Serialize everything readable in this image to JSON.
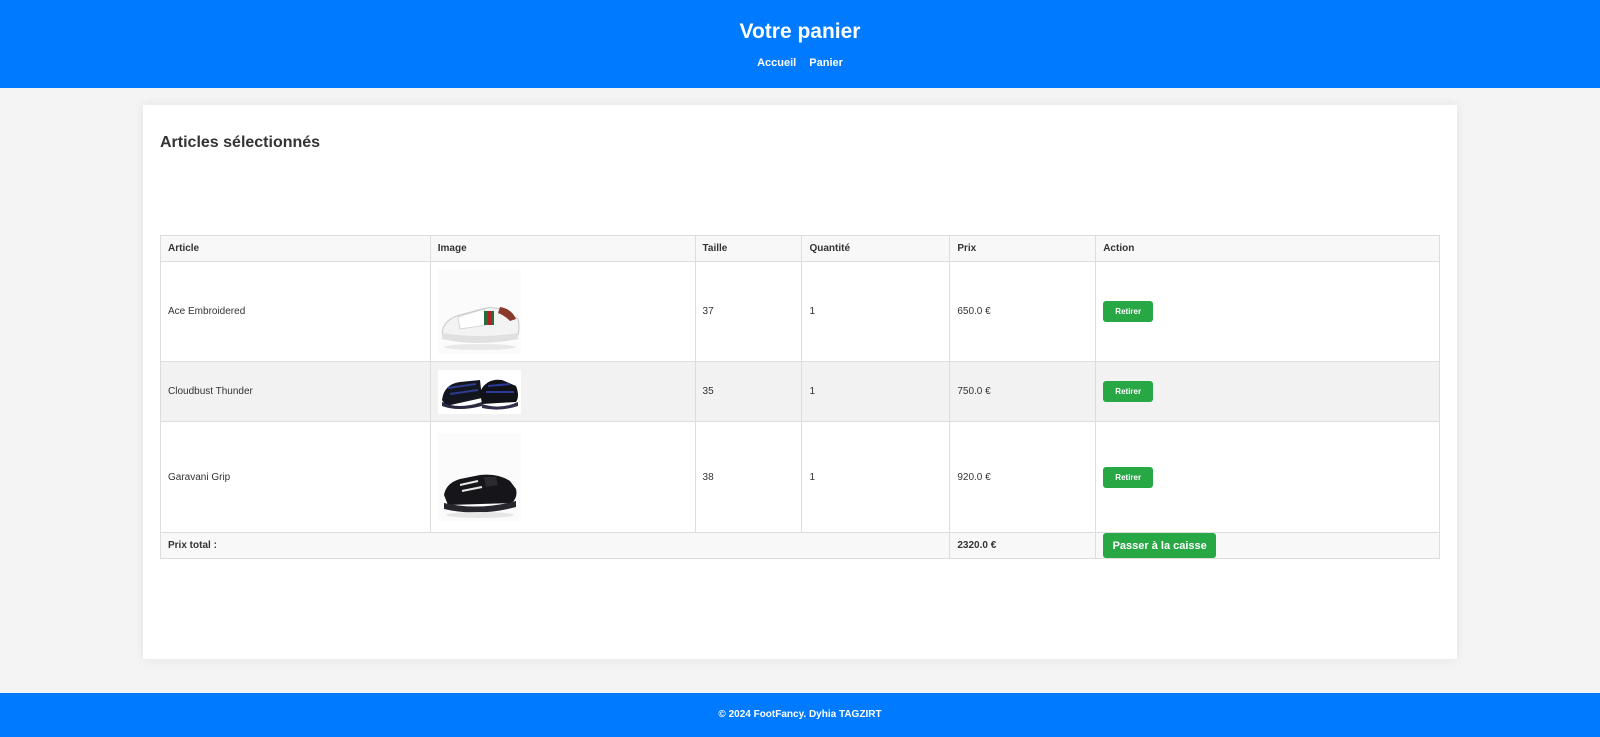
{
  "header": {
    "title": "Votre panier",
    "nav": [
      {
        "label": "Accueil"
      },
      {
        "label": "Panier"
      }
    ]
  },
  "main": {
    "section_title": "Articles sélectionnés",
    "table": {
      "headers": [
        "Article",
        "Image",
        "Taille",
        "Quantité",
        "Prix",
        "Action"
      ],
      "rows": [
        {
          "article": "Ace Embroidered",
          "image": "white-sneaker-image",
          "taille": "37",
          "quantite": "1",
          "prix": "650.0 €",
          "action": "Retirer"
        },
        {
          "article": "Cloudbust Thunder",
          "image": "black-runner-sneaker-image",
          "taille": "35",
          "quantite": "1",
          "prix": "750.0 €",
          "action": "Retirer"
        },
        {
          "article": "Garavani Grip",
          "image": "black-low-sneaker-image",
          "taille": "38",
          "quantite": "1",
          "prix": "920.0 €",
          "action": "Retirer"
        }
      ],
      "total_label": "Prix total :",
      "total_value": "2320.0 €",
      "checkout_label": "Passer à la caisse"
    }
  },
  "footer": {
    "text": "© 2024 FootFancy. Dyhia TAGZIRT"
  },
  "colors": {
    "primary": "#007bff",
    "button": "#28a745",
    "background": "#f4f4f4"
  }
}
